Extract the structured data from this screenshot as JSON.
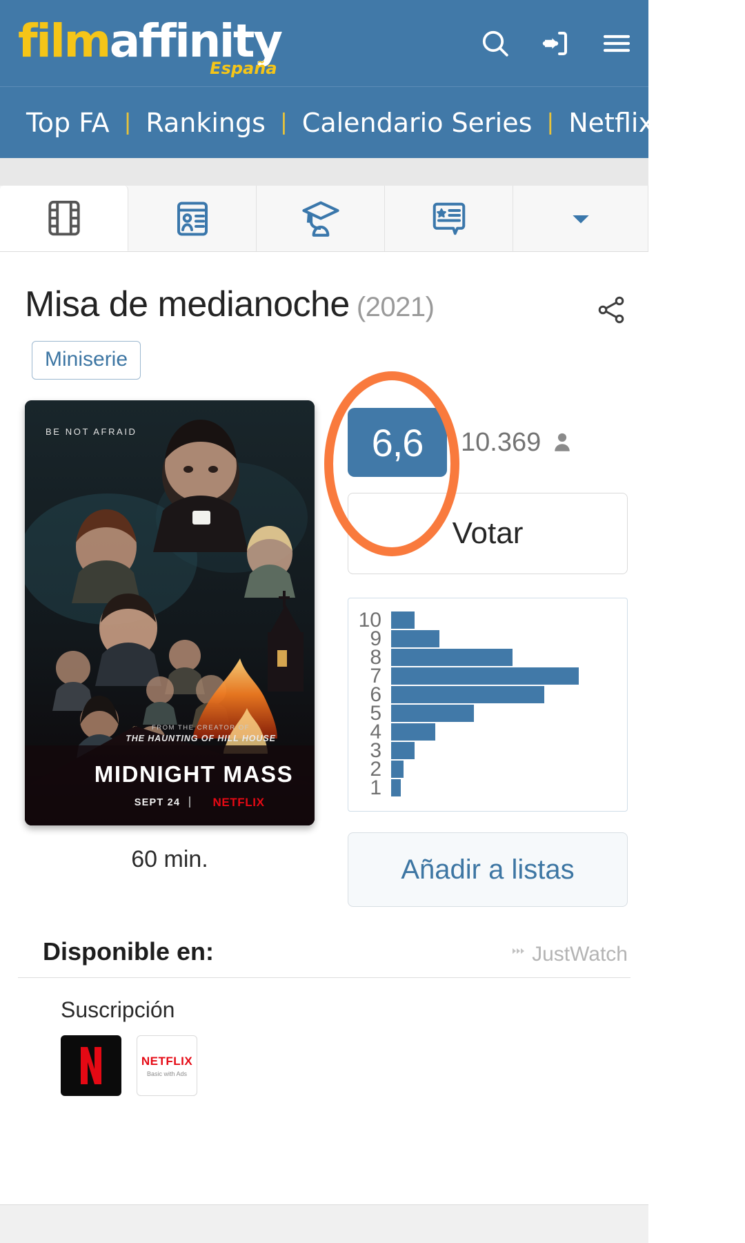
{
  "header": {
    "logo_film": "film",
    "logo_affinity": "affinity",
    "logo_country": "España",
    "icons": {
      "search": "search-icon",
      "login": "login-icon",
      "menu": "hamburger-menu-icon"
    }
  },
  "nav": {
    "items": [
      {
        "label": "Top FA"
      },
      {
        "label": "Rankings"
      },
      {
        "label": "Calendario Series"
      },
      {
        "label": "Netflix"
      }
    ],
    "separator": "|"
  },
  "tabs": [
    {
      "name": "film-strip",
      "icon": "film-strip-icon",
      "active": true
    },
    {
      "name": "cast-card",
      "icon": "id-card-icon",
      "active": false
    },
    {
      "name": "awards",
      "icon": "graduation-cap-icon",
      "active": false
    },
    {
      "name": "reviews",
      "icon": "review-comment-icon",
      "active": false
    },
    {
      "name": "more",
      "icon": "chevron-down-icon",
      "active": false
    }
  ],
  "title": {
    "name": "Misa de medianoche",
    "year": "(2021)",
    "badge": "Miniserie",
    "share_icon": "share-icon"
  },
  "poster": {
    "tagline": "BE NOT AFRAID",
    "from_creator": "FROM THE CREATOR OF",
    "creator_work": "THE HAUNTING OF HILL HOUSE",
    "main_title": "MIDNIGHT MASS",
    "date": "SEPT 24",
    "network": "NETFLIX"
  },
  "runtime": "60 min.",
  "rating": {
    "score": "6,6",
    "votes": "10.369",
    "votes_icon": "person-icon",
    "vote_button": "Votar",
    "add_to_lists_button": "Añadir a listas",
    "highlight_color": "#f97a3d",
    "accent_color": "#4179a8"
  },
  "chart_data": {
    "type": "bar",
    "orientation": "horizontal",
    "title": "",
    "xlabel": "",
    "ylabel": "",
    "categories": [
      "10",
      "9",
      "8",
      "7",
      "6",
      "5",
      "4",
      "3",
      "2",
      "1"
    ],
    "values": [
      7,
      20,
      51,
      78,
      64,
      35,
      19,
      10,
      5,
      4
    ],
    "bar_color": "#4179a8",
    "grid": false,
    "legend": false
  },
  "available": {
    "title": "Disponible en:",
    "attribution": "JustWatch",
    "subscription_label": "Suscripción",
    "providers": [
      {
        "name": "netflix",
        "mark": "N"
      },
      {
        "name": "netflix-basic-with-ads",
        "top": "NETFLIX",
        "bottom": "Basic with Ads"
      }
    ]
  }
}
